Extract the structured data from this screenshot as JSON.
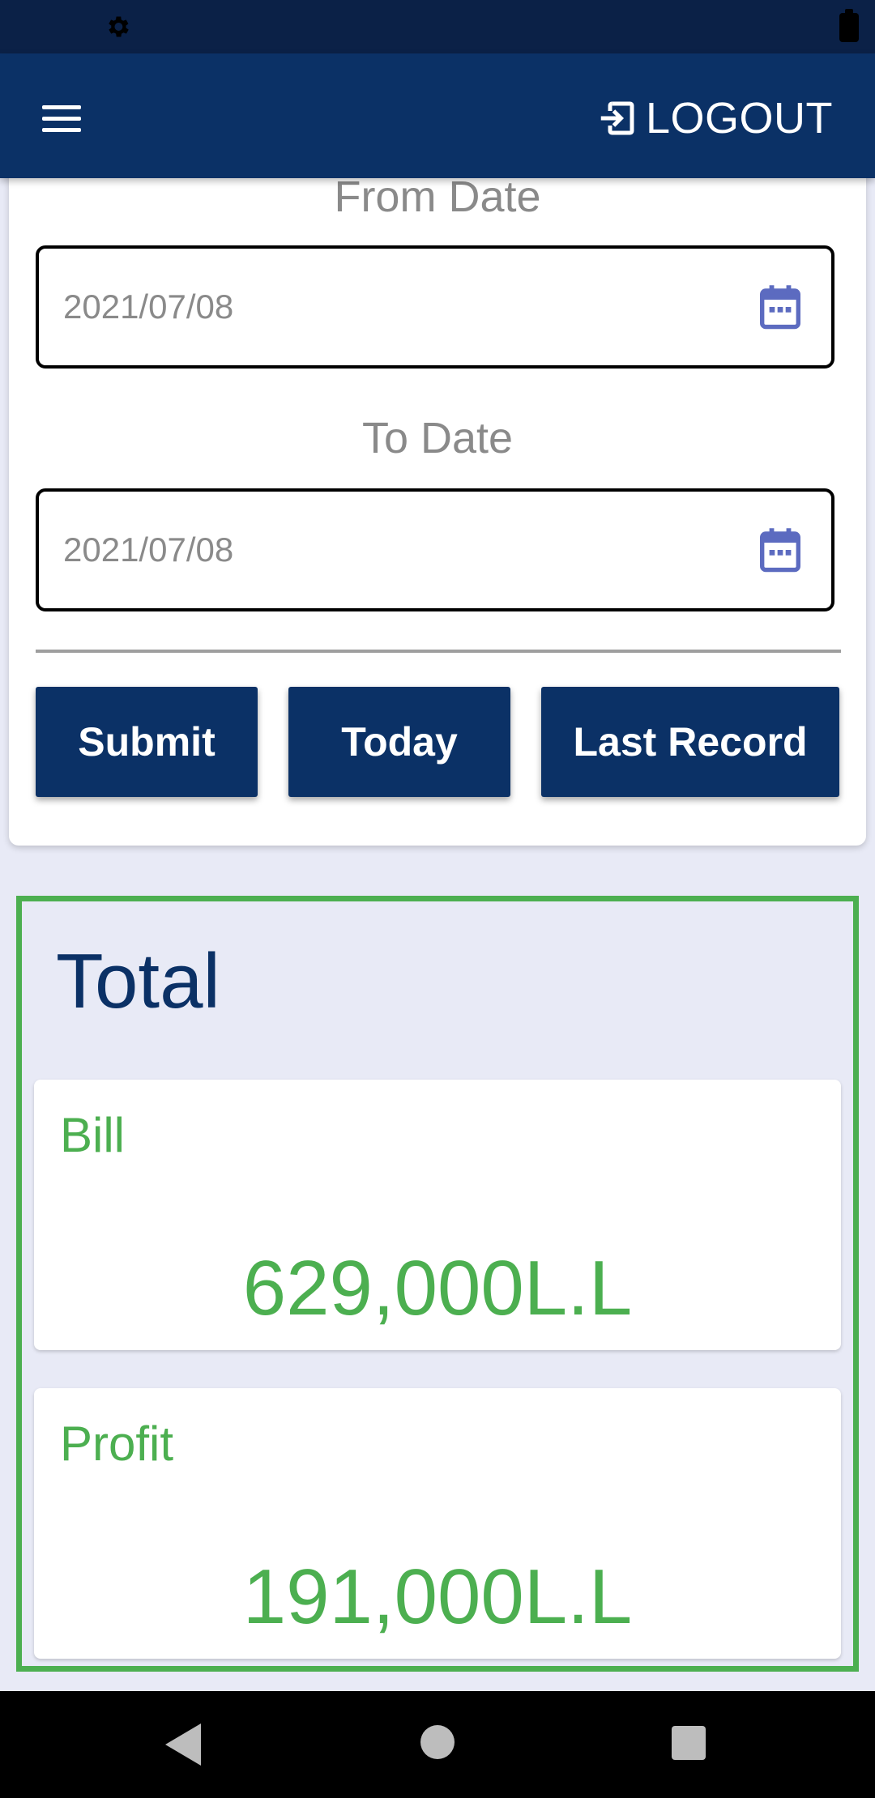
{
  "header": {
    "logout_label": "LOGOUT"
  },
  "filter": {
    "from_label": "From Date",
    "from_value": "2021/07/08",
    "to_label": "To Date",
    "to_value": "2021/07/08",
    "buttons": {
      "submit": "Submit",
      "today": "Today",
      "last_record": "Last Record"
    }
  },
  "totals": {
    "title": "Total",
    "bill": {
      "label": "Bill",
      "value": "629,000L.L"
    },
    "profit": {
      "label": "Profit",
      "value": "191,000L.L"
    }
  },
  "colors": {
    "primary": "#0b3166",
    "accent": "#4caf50",
    "background": "#e8eaf6"
  },
  "icons": {
    "status_left": "gear-icon",
    "status_right": "battery-icon",
    "menu": "hamburger-menu-icon",
    "logout": "logout-icon",
    "date_picker": "calendar-icon",
    "nav_back": "back-icon",
    "nav_home": "home-icon",
    "nav_recent": "recent-apps-icon"
  }
}
